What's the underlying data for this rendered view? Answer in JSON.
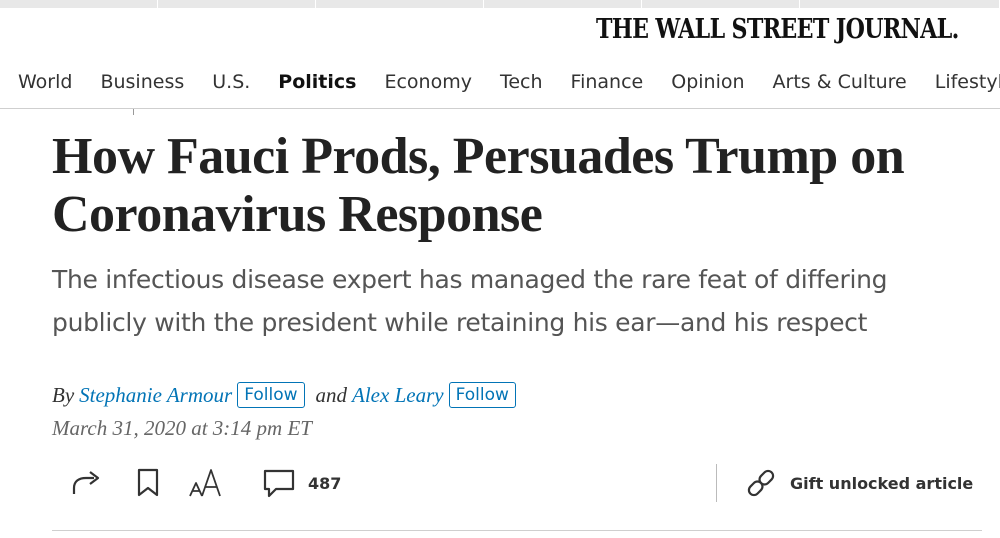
{
  "masthead": {
    "title": "THE WALL STREET JOURNAL."
  },
  "nav": {
    "items": [
      "World",
      "Business",
      "U.S.",
      "Politics",
      "Economy",
      "Tech",
      "Finance",
      "Opinion",
      "Arts & Culture",
      "Lifestyle"
    ],
    "active": "Politics"
  },
  "article": {
    "headline": "How Fauci Prods, Persuades Trump on Coronavirus Response",
    "subhead": "The infectious disease expert has managed the rare feat of differing publicly with the president while retaining his ear—and his respect",
    "byline": {
      "by": "By",
      "author1": "Stephanie Armour",
      "follow1": "Follow",
      "and": "and",
      "author2": "Alex Leary",
      "follow2": "Follow"
    },
    "timestamp": "March 31, 2020 at 3:14 pm ET"
  },
  "toolbar": {
    "share_icon": "share-arrow-icon",
    "bookmark_icon": "bookmark-icon",
    "textsize_icon": "text-size-icon",
    "textsize_label": "AA",
    "comment_icon": "comment-bubble-icon",
    "comment_count": "487",
    "gift_icon": "link-icon",
    "gift_label": "Gift unlocked article"
  },
  "colors": {
    "link": "#0274b6",
    "text": "#222222",
    "subtext": "#555555"
  }
}
